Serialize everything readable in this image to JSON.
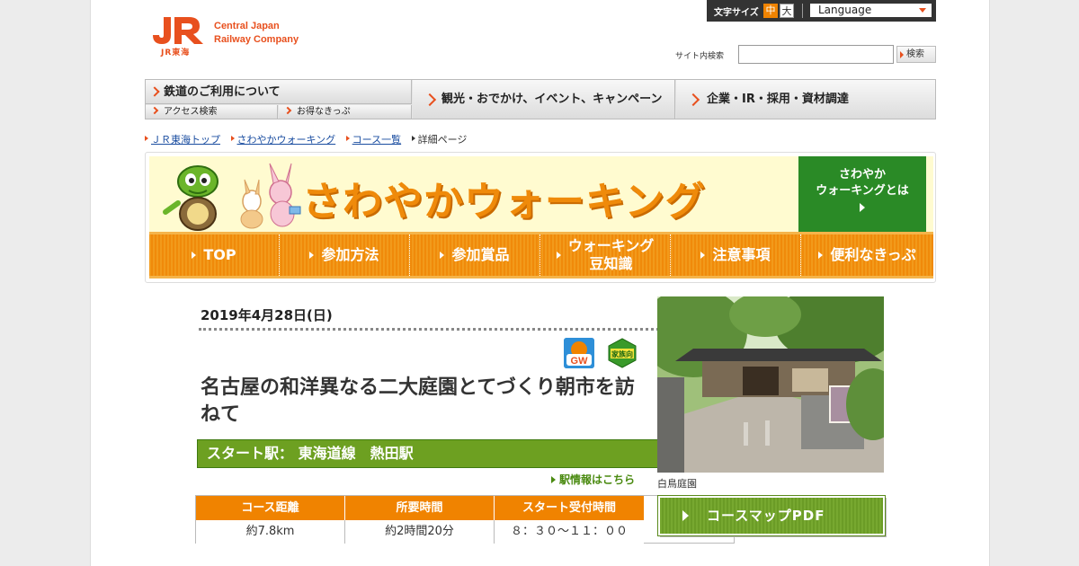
{
  "header": {
    "logo_mark": "JR",
    "logo_sub": "JR東海",
    "logo_line1": "Central Japan",
    "logo_line2": "Railway Company",
    "font_size_label": "文字サイズ",
    "font_mid": "中",
    "font_big": "大",
    "language": "Language",
    "search_label": "サイト内検索",
    "search_value": "",
    "search_button": "検索"
  },
  "gnav": {
    "rail": "鉄道のご利用について",
    "access": "アクセス検索",
    "tickets": "お得なきっぷ",
    "tour": "観光・おでかけ、イベント、キャンペーン",
    "corp": "企業・IR・採用・資材調達"
  },
  "breadcrumb": [
    "ＪＲ東海トップ",
    "さわやかウォーキング",
    "コース一覧",
    "詳細ページ"
  ],
  "banner": {
    "title": "さわやかウォーキング",
    "about_line1": "さわやか",
    "about_line2": "ウォーキングとは",
    "tabs": [
      "TOP",
      "参加方法",
      "参加賞品",
      "ウォーキング|豆知識",
      "注意事項",
      "便利なきっぷ"
    ]
  },
  "course": {
    "date": "2019年4月28日(日)",
    "badge_gw": "GW",
    "badge_family": "家族向",
    "title": "名古屋の和洋異なる二大庭園とてづくり朝市を訪ねて",
    "start_label": "スタート駅：",
    "start_station": "東海道線　熱田駅",
    "station_link": "駅情報はこちら",
    "table_headers": [
      "コース距離",
      "所要時間",
      "スタート受付時間"
    ],
    "table_values": [
      "約7.8km",
      "約2時間20分",
      "８：３０～１１：００"
    ],
    "photo_caption": "白鳥庭園",
    "map_button": "コースマップPDF"
  },
  "colors": {
    "brand": "#e8501e",
    "accent_orange": "#f08300",
    "green": "#6da021"
  }
}
